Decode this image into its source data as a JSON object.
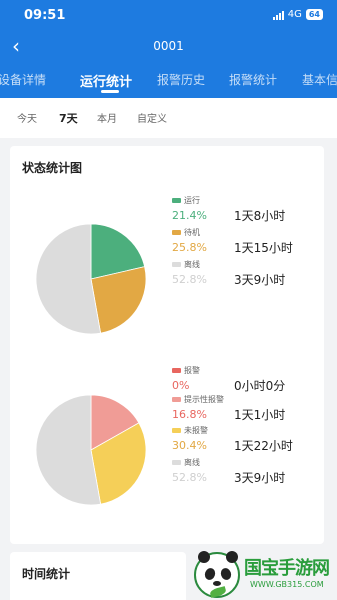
{
  "status_bar": {
    "time": "09:51",
    "network": "4G",
    "battery": "64"
  },
  "navbar": {
    "title": "0001",
    "back_icon": "chevron-left-icon"
  },
  "tabs": [
    {
      "label": "设备详情",
      "active": false
    },
    {
      "label": "运行统计",
      "active": true
    },
    {
      "label": "报警历史",
      "active": false
    },
    {
      "label": "报警统计",
      "active": false
    },
    {
      "label": "基本信",
      "active": false
    }
  ],
  "filters": [
    {
      "label": "今天",
      "active": false
    },
    {
      "label": "7天",
      "active": true
    },
    {
      "label": "本月",
      "active": false
    },
    {
      "label": "自定义",
      "active": false
    }
  ],
  "status_card": {
    "title": "状态统计图",
    "chart1": [
      {
        "name": "运行",
        "percent": "21.4%",
        "duration": "1天8小时",
        "value": 21.4,
        "color": "#4caf7d"
      },
      {
        "name": "待机",
        "percent": "25.8%",
        "duration": "1天15小时",
        "value": 25.8,
        "color": "#e2a844"
      },
      {
        "name": "离线",
        "percent": "52.8%",
        "duration": "3天9小时",
        "value": 52.8,
        "color": "#dcdcdc"
      }
    ],
    "chart2": [
      {
        "name": "报警",
        "percent": "0%",
        "duration": "0小时0分",
        "value": 0,
        "color": "#e8665f"
      },
      {
        "name": "提示性报警",
        "percent": "16.8%",
        "duration": "1天1小时",
        "value": 16.8,
        "color": "#f09c96"
      },
      {
        "name": "未报警",
        "percent": "30.4%",
        "duration": "1天22小时",
        "value": 30.4,
        "color": "#f5cf58"
      },
      {
        "name": "离线",
        "percent": "52.8%",
        "duration": "3天9小时",
        "value": 52.8,
        "color": "#dcdcdc"
      }
    ]
  },
  "time_card": {
    "title": "时间统计"
  },
  "watermark": {
    "text": "国宝手游网",
    "url": "WWW.GB315.COM"
  }
}
